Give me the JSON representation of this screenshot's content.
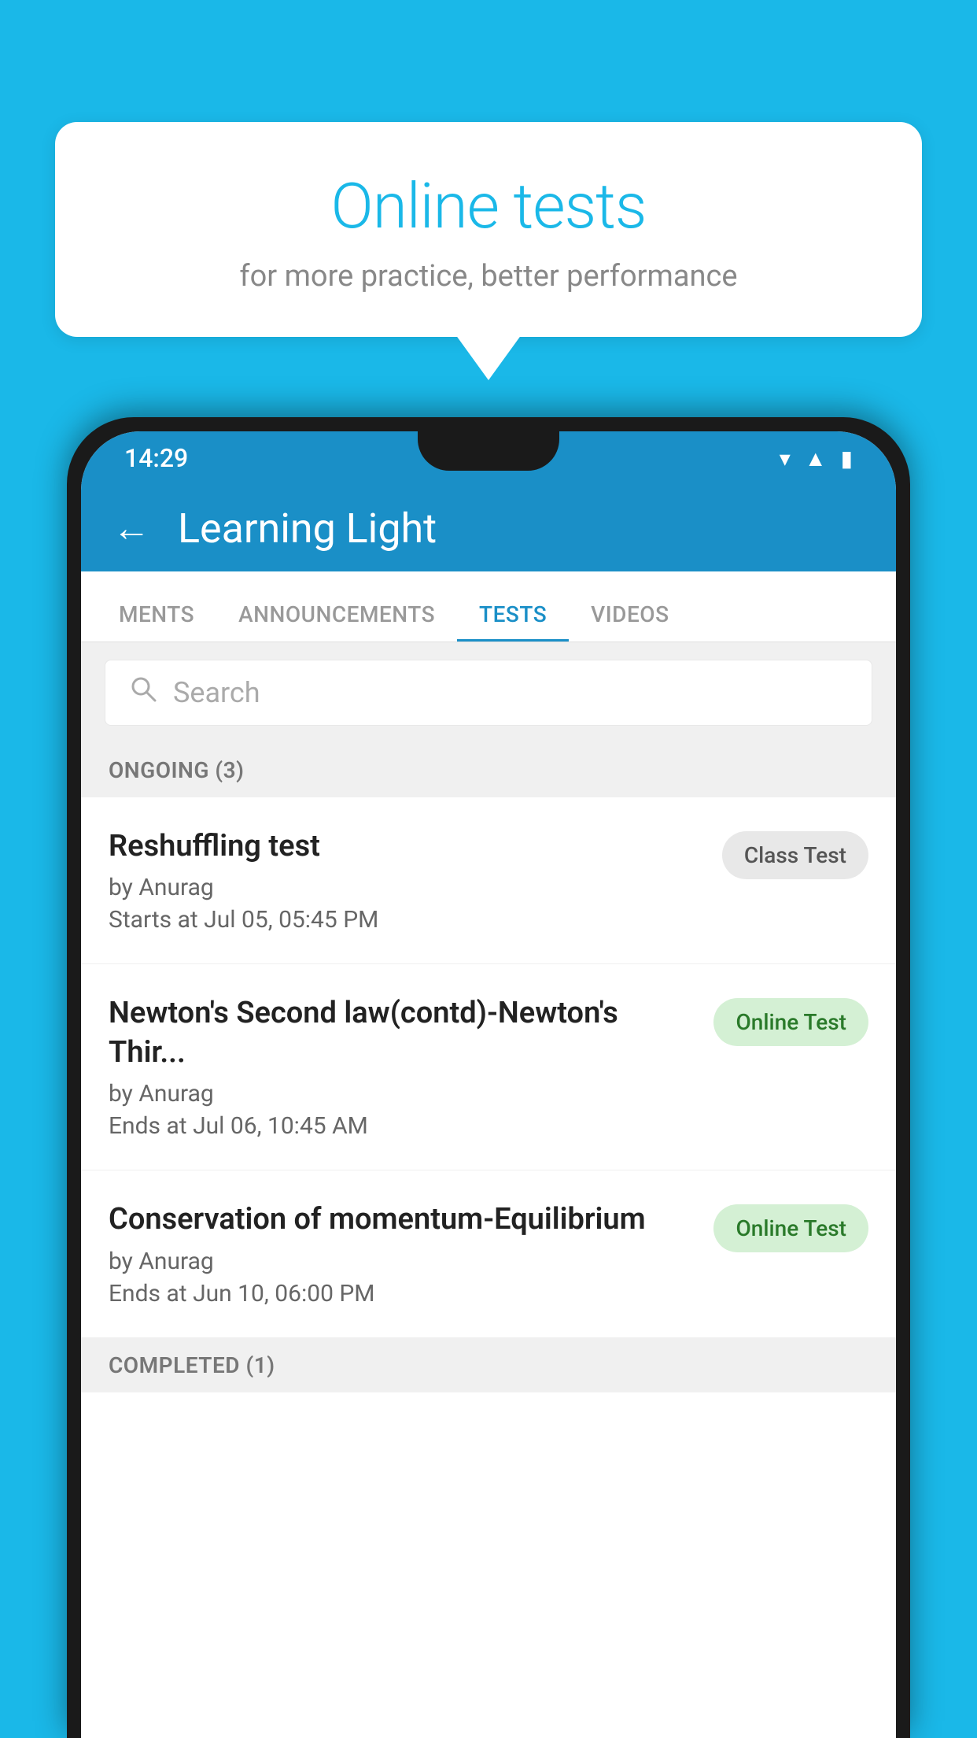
{
  "background_color": "#1ab8e8",
  "speech_bubble": {
    "title": "Online tests",
    "subtitle": "for more practice, better performance"
  },
  "phone": {
    "status_bar": {
      "time": "14:29",
      "icons": [
        "wifi",
        "signal",
        "battery"
      ]
    },
    "app_header": {
      "title": "Learning Light",
      "back_label": "←"
    },
    "tabs": [
      {
        "label": "MENTS",
        "active": false
      },
      {
        "label": "ANNOUNCEMENTS",
        "active": false
      },
      {
        "label": "TESTS",
        "active": true
      },
      {
        "label": "VIDEOS",
        "active": false
      }
    ],
    "search": {
      "placeholder": "Search"
    },
    "ongoing_section": {
      "label": "ONGOING (3)"
    },
    "tests": [
      {
        "name": "Reshuffling test",
        "author": "by Anurag",
        "time_label": "Starts at",
        "time_value": "Jul 05, 05:45 PM",
        "badge": "Class Test",
        "badge_type": "class"
      },
      {
        "name": "Newton's Second law(contd)-Newton's Thir...",
        "author": "by Anurag",
        "time_label": "Ends at",
        "time_value": "Jul 06, 10:45 AM",
        "badge": "Online Test",
        "badge_type": "online"
      },
      {
        "name": "Conservation of momentum-Equilibrium",
        "author": "by Anurag",
        "time_label": "Ends at",
        "time_value": "Jun 10, 06:00 PM",
        "badge": "Online Test",
        "badge_type": "online"
      }
    ],
    "completed_section": {
      "label": "COMPLETED (1)"
    }
  }
}
